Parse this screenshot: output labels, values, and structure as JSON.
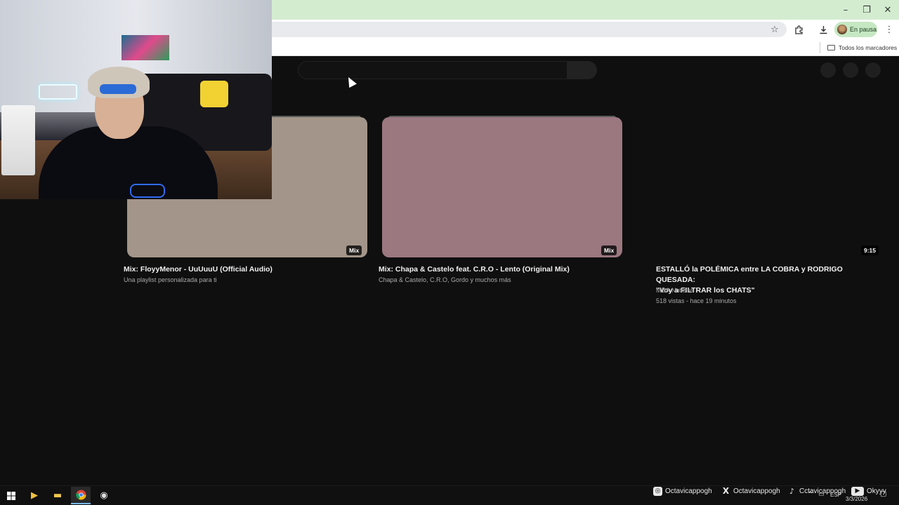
{
  "browser": {
    "window_controls": {
      "minimize": "–",
      "restore": "❐",
      "close": "✕"
    },
    "profile_chip": {
      "label": "En pausa"
    },
    "bookmarks_bar": {
      "all_bookmarks": "Todos los marcadores"
    }
  },
  "videos": [
    {
      "title": "Mix: FloyyMenor - UuUuuU (Official Audio)",
      "meta1": "Una playlist personalizada para ti",
      "badge": "Mix",
      "thumb_color": "#a39589"
    },
    {
      "title": "Mix: Chapa & Castelo feat. C.R.O - Lento (Original Mix)",
      "meta1": "Chapa & Castelo, C.R.O, Gordo y muchos más",
      "badge": "Mix",
      "thumb_color": "#9b7780"
    },
    {
      "title_line1": "ESTALLÓ la POLÉMICA entre LA COBRA y RODRIGO QUESADA:",
      "title_line2": "\"Voy a FILTRAR los CHATS\"",
      "channel": "MDA Noticias",
      "stats": "518 vistas - hace 19 minutos",
      "badge": "9:15"
    }
  ],
  "overlay_socials": [
    {
      "icon": "instagram-icon",
      "glyph": "◎",
      "handle": "Octavicappogh"
    },
    {
      "icon": "x-icon",
      "glyph": "X",
      "handle": "Octavicappogh"
    },
    {
      "icon": "tiktok-icon",
      "glyph": "♪",
      "handle": "Cctavicappogh"
    },
    {
      "icon": "youtube-icon",
      "glyph": "▶",
      "handle": "Okyyy"
    }
  ],
  "taskbar": {
    "lang": "ESP",
    "date": "3/3/2026"
  },
  "colors": {
    "titlebar": "#d3ecd0",
    "page_bg": "#0f0f0f"
  }
}
